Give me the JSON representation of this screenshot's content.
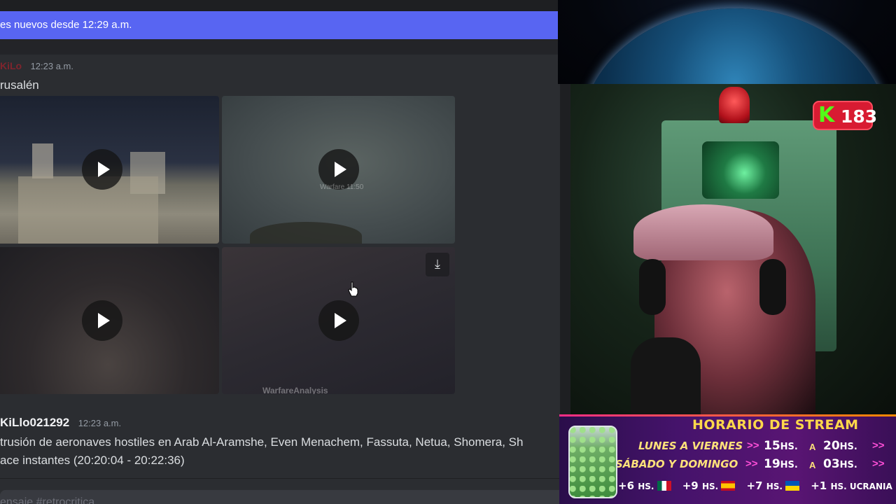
{
  "chat": {
    "banner_text": "es nuevos desde 12:29 a.m.",
    "message1": {
      "author": "KiLo",
      "timestamp": "12:23 a.m.",
      "text": "rusalén"
    },
    "attachments": [
      {
        "name": "video-1"
      },
      {
        "name": "video-2",
        "overlay_label": "Warfare 11:50"
      },
      {
        "name": "video-3"
      },
      {
        "name": "video-4",
        "overlay_label": "WarfareAnalysis"
      }
    ],
    "message2": {
      "author": "KiLlo021292",
      "timestamp": "12:23 a.m.",
      "line1": "trusión de aeronaves hostiles en Arab Al-Aramshe, Even Menachem, Fassuta, Netua, Shomera, Sh",
      "line2": "ace instantes (20:20:04 - 20:22:36)"
    },
    "input_placeholder": "ensaje #retrocritica",
    "icons": {
      "download": "download-icon",
      "play": "play-icon",
      "cursor": "hand-pointer-icon"
    },
    "colors": {
      "banner": "#5865f2",
      "background": "#2b2d31"
    }
  },
  "stream": {
    "viewer_count": "183",
    "viewer_platform_letter": "K",
    "schedule": {
      "title": "HORARIO DE STREAM",
      "rows": [
        {
          "days": "LUNES A VIERNES",
          "arrows": ">>",
          "start": "15",
          "start_unit": "HS.",
          "sep": "A",
          "end": "20",
          "end_unit": "HS.",
          "tail": ">>"
        },
        {
          "days": "SÁBADO Y DOMINGO",
          "arrows": ">>",
          "start": "19",
          "start_unit": "HS.",
          "sep": "A",
          "end": "03",
          "end_unit": "HS.",
          "tail": ">>"
        }
      ],
      "timezones": [
        {
          "offset": "+6",
          "unit": "HS.",
          "flag": "mx"
        },
        {
          "offset": "+9",
          "unit": "HS.",
          "flag": "es"
        },
        {
          "offset": "+7",
          "unit": "HS.",
          "flag": "ua"
        },
        {
          "offset": "+1",
          "unit": "HS. UCRANIA",
          "flag": ""
        }
      ]
    },
    "colors": {
      "kick_green": "#53fc18",
      "badge_red": "#d81b32",
      "schedule_title": "#ffd84a"
    }
  }
}
